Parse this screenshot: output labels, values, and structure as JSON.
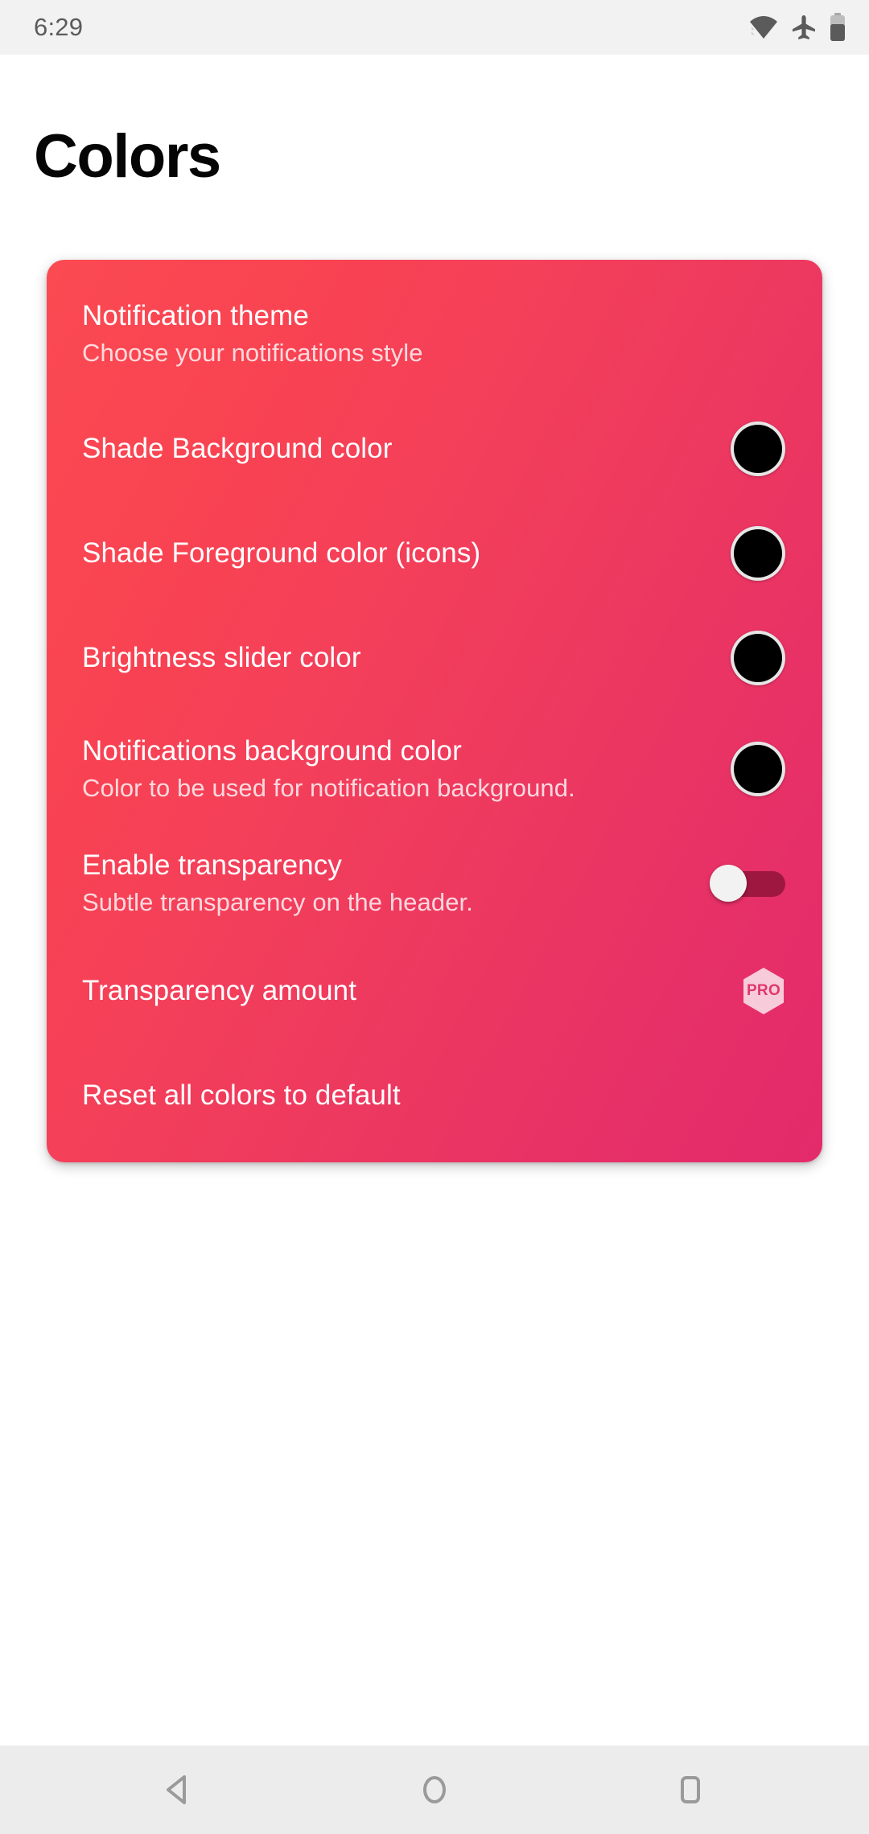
{
  "status_bar": {
    "time": "6:29",
    "icons": [
      "wifi-icon",
      "airplane-mode-icon",
      "battery-icon"
    ]
  },
  "page": {
    "title": "Colors"
  },
  "card": {
    "gradient_from": "#fb4a52",
    "gradient_to": "#e32a6b",
    "swatch_color": "#000000",
    "pro_badge_color": "#f7c5d6",
    "rows": [
      {
        "id": "notification-theme",
        "title": "Notification theme",
        "subtitle": "Choose your notifications style",
        "control": "none"
      },
      {
        "id": "shade-background-color",
        "title": "Shade Background color",
        "subtitle": "",
        "control": "color-swatch"
      },
      {
        "id": "shade-foreground-color",
        "title": "Shade Foreground color (icons)",
        "subtitle": "",
        "control": "color-swatch"
      },
      {
        "id": "brightness-slider-color",
        "title": "Brightness slider color",
        "subtitle": "",
        "control": "color-swatch"
      },
      {
        "id": "notifications-background-color",
        "title": "Notifications background color",
        "subtitle": "Color to be used for notification background.",
        "control": "color-swatch"
      },
      {
        "id": "enable-transparency",
        "title": "Enable transparency",
        "subtitle": "Subtle transparency on the header.",
        "control": "toggle",
        "toggle_state": "off"
      },
      {
        "id": "transparency-amount",
        "title": "Transparency amount",
        "subtitle": "",
        "control": "pro-badge",
        "badge_label": "PRO"
      },
      {
        "id": "reset-all-colors",
        "title": "Reset all colors to default",
        "subtitle": "",
        "control": "none"
      }
    ]
  },
  "nav_bar": {
    "back_label": "Back",
    "home_label": "Home",
    "recents_label": "Recents"
  }
}
